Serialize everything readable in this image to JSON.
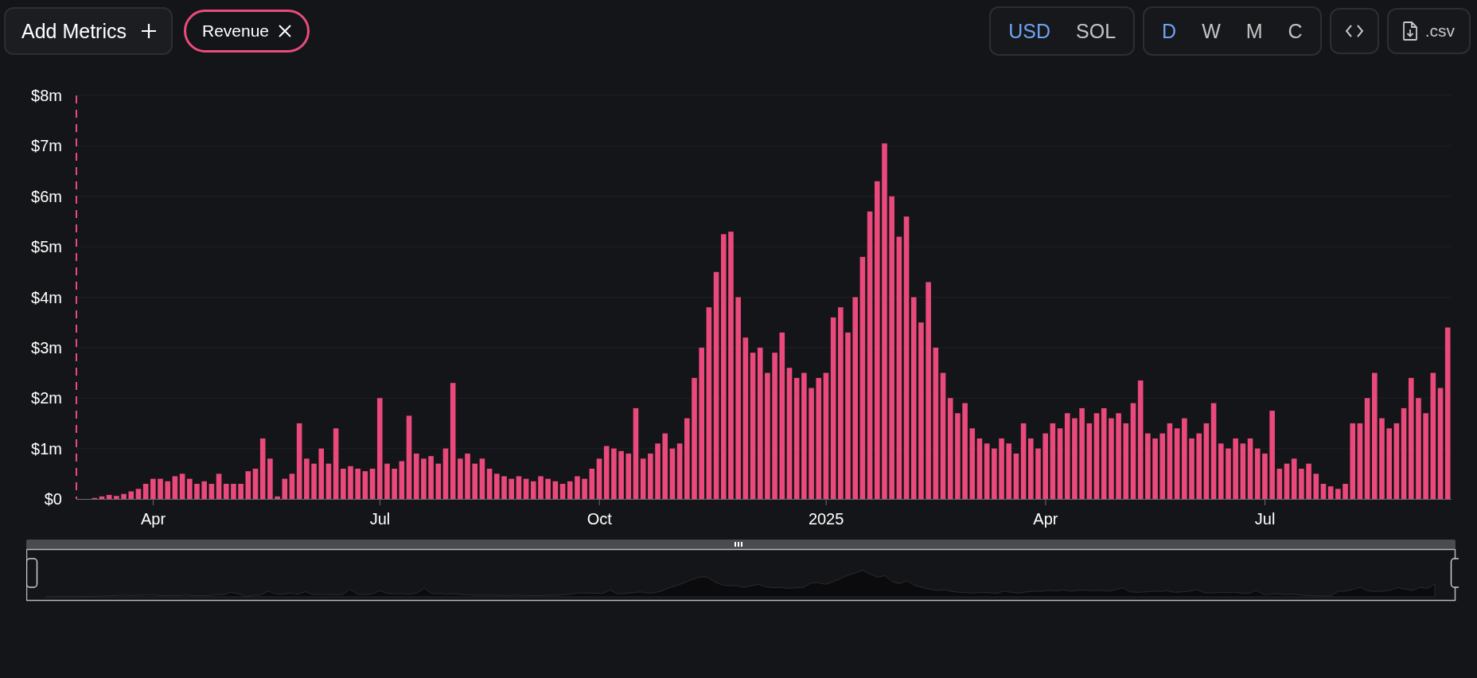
{
  "toolbar": {
    "add_metrics": {
      "label": "Add Metrics"
    },
    "currency": [
      {
        "label": "USD",
        "selected": true
      },
      {
        "label": "SOL",
        "selected": false
      }
    ],
    "period": [
      {
        "label": "D",
        "selected": true
      },
      {
        "label": "W",
        "selected": false
      },
      {
        "label": "M",
        "selected": false
      },
      {
        "label": "C",
        "selected": false
      }
    ],
    "csv_button": {
      "label": ".csv"
    }
  },
  "chart": {
    "chart_data": {
      "type": "bar",
      "categories": [
        null,
        null,
        null,
        null,
        null,
        null,
        null,
        null,
        null,
        null,
        "Apr",
        null,
        null,
        null,
        null,
        null,
        null,
        null,
        null,
        null,
        null,
        null,
        null,
        null,
        null,
        null,
        null,
        null,
        null,
        null,
        null,
        null,
        null,
        null,
        null,
        null,
        null,
        null,
        null,
        null,
        null,
        "Jul",
        null,
        null,
        null,
        null,
        null,
        null,
        null,
        null,
        null,
        null,
        null,
        null,
        null,
        null,
        null,
        null,
        null,
        null,
        null,
        null,
        null,
        null,
        null,
        null,
        null,
        null,
        null,
        null,
        null,
        "Oct",
        null,
        null,
        null,
        null,
        null,
        null,
        null,
        null,
        null,
        null,
        null,
        null,
        null,
        null,
        null,
        null,
        null,
        null,
        null,
        null,
        null,
        null,
        null,
        null,
        null,
        null,
        null,
        null,
        null,
        null,
        "2025",
        null,
        null,
        null,
        null,
        null,
        null,
        null,
        null,
        null,
        null,
        null,
        null,
        null,
        null,
        null,
        null,
        null,
        null,
        null,
        null,
        null,
        null,
        null,
        null,
        null,
        null,
        null,
        null,
        null,
        "Apr",
        null,
        null,
        null,
        null,
        null,
        null,
        null,
        null,
        null,
        null,
        null,
        null,
        null,
        null,
        null,
        null,
        null,
        null,
        null,
        null,
        null,
        null,
        null,
        null,
        null,
        null,
        null,
        null,
        null,
        "Jul",
        null,
        null,
        null,
        null,
        null,
        null,
        null,
        null,
        null,
        null,
        null,
        null,
        null,
        null,
        null,
        null,
        null,
        null,
        null,
        null,
        null,
        null,
        null,
        null,
        null
      ],
      "series": [
        {
          "name": "Revenue",
          "color": "#e9497b",
          "values": [
            0,
            0,
            0.02,
            0.05,
            0.08,
            0.06,
            0.1,
            0.15,
            0.2,
            0.3,
            0.4,
            0.4,
            0.35,
            0.45,
            0.5,
            0.4,
            0.3,
            0.35,
            0.3,
            0.5,
            0.3,
            0.3,
            0.3,
            0.55,
            0.6,
            1.2,
            0.8,
            0.05,
            0.4,
            0.5,
            1.5,
            0.8,
            0.7,
            1.0,
            0.7,
            1.4,
            0.6,
            0.65,
            0.6,
            0.55,
            0.6,
            2.0,
            0.7,
            0.6,
            0.75,
            1.65,
            0.9,
            0.8,
            0.85,
            0.7,
            1.0,
            2.3,
            0.8,
            0.9,
            0.7,
            0.8,
            0.6,
            0.5,
            0.45,
            0.4,
            0.45,
            0.4,
            0.35,
            0.45,
            0.4,
            0.35,
            0.3,
            0.35,
            0.45,
            0.4,
            0.6,
            0.8,
            1.05,
            1.0,
            0.95,
            0.9,
            1.8,
            0.8,
            0.9,
            1.1,
            1.3,
            1.0,
            1.1,
            1.6,
            2.4,
            3.0,
            3.8,
            4.5,
            5.25,
            5.3,
            4.0,
            3.2,
            2.9,
            3.0,
            2.5,
            2.9,
            3.3,
            2.6,
            2.4,
            2.5,
            2.2,
            2.4,
            2.5,
            3.6,
            3.8,
            3.3,
            4.0,
            4.8,
            5.7,
            6.3,
            7.05,
            6.0,
            5.2,
            5.6,
            4.0,
            3.5,
            4.3,
            3.0,
            2.5,
            2.0,
            1.7,
            1.9,
            1.4,
            1.2,
            1.1,
            1.0,
            1.2,
            1.1,
            0.9,
            1.5,
            1.2,
            1.0,
            1.3,
            1.5,
            1.4,
            1.7,
            1.6,
            1.8,
            1.5,
            1.7,
            1.8,
            1.6,
            1.7,
            1.5,
            1.9,
            2.35,
            1.3,
            1.2,
            1.3,
            1.5,
            1.4,
            1.6,
            1.2,
            1.3,
            1.5,
            1.9,
            1.1,
            1.0,
            1.2,
            1.1,
            1.2,
            1.0,
            0.9,
            1.75,
            0.6,
            0.7,
            0.8,
            0.6,
            0.7,
            0.5,
            0.3,
            0.25,
            0.2,
            0.3,
            1.5,
            1.5,
            2.0,
            2.5,
            1.6,
            1.4,
            1.5,
            1.8,
            2.4,
            2.0,
            1.7,
            2.5,
            2.2,
            3.4
          ]
        }
      ],
      "ylim": [
        0,
        8
      ],
      "yticks": [
        {
          "value": 0,
          "label": "$0"
        },
        {
          "value": 1,
          "label": "$1m"
        },
        {
          "value": 2,
          "label": "$2m"
        },
        {
          "value": 3,
          "label": "$3m"
        },
        {
          "value": 4,
          "label": "$4m"
        },
        {
          "value": 5,
          "label": "$5m"
        },
        {
          "value": 6,
          "label": "$6m"
        },
        {
          "value": 7,
          "label": "$7m"
        },
        {
          "value": 8,
          "label": "$8m"
        }
      ],
      "grid": true
    }
  }
}
